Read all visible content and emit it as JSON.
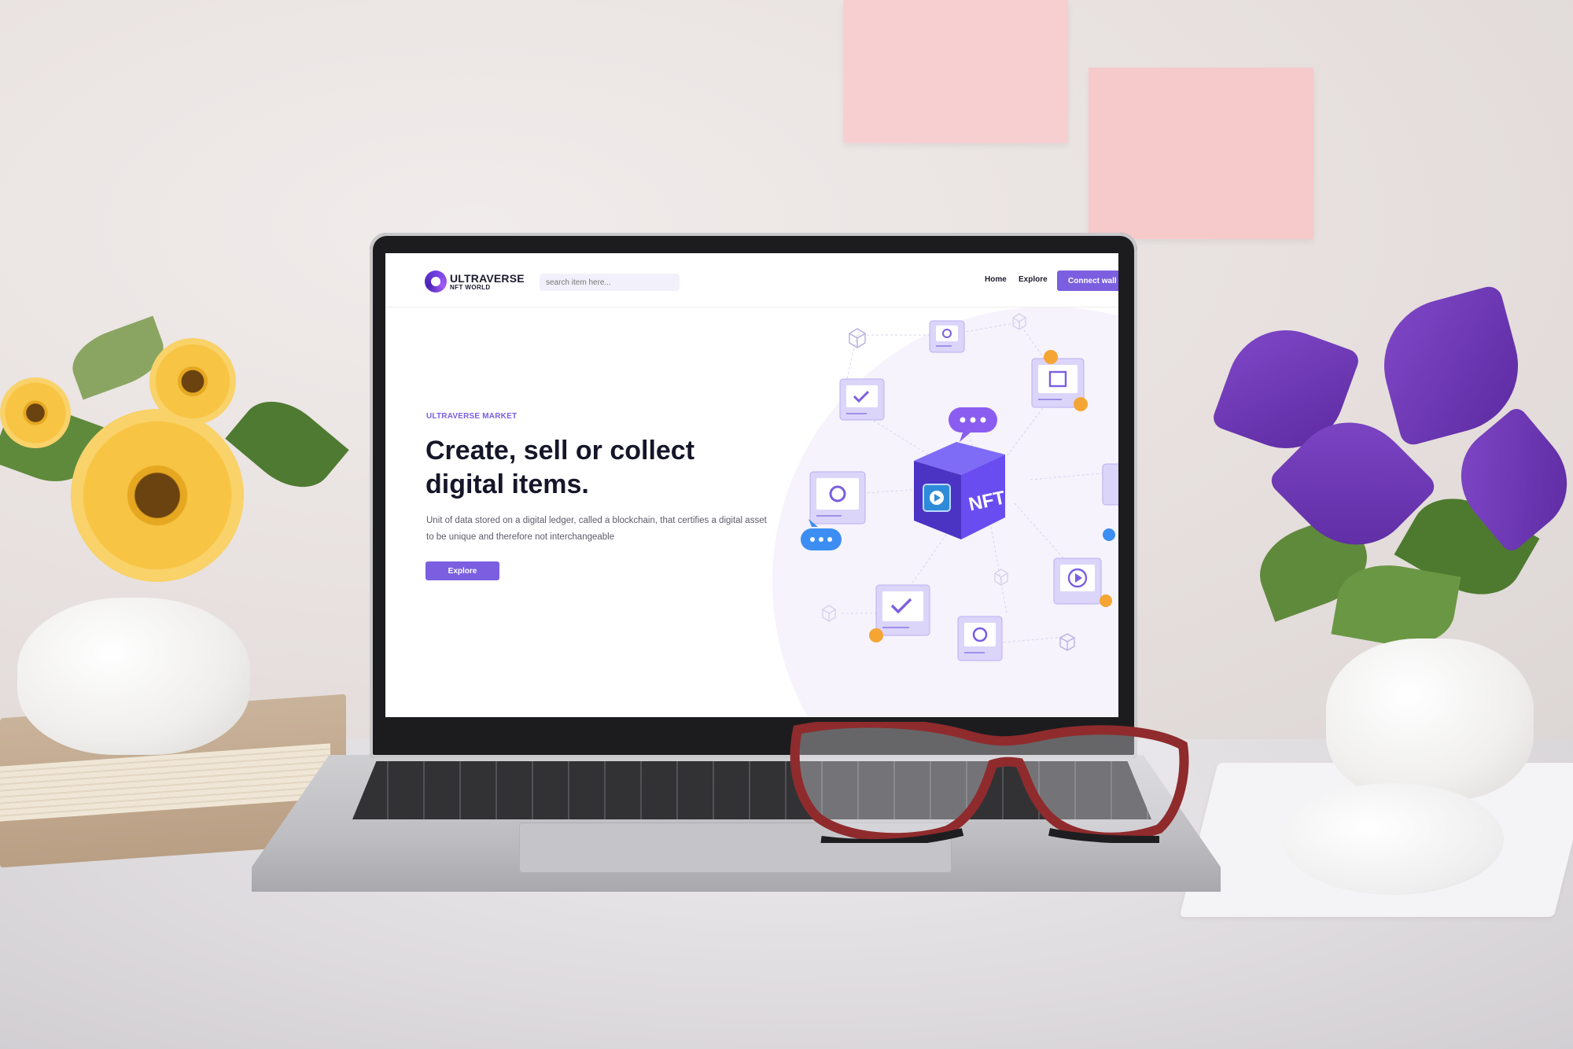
{
  "site": {
    "logo_title": "ULTRAVERSE",
    "logo_subtitle": "NFT WORLD"
  },
  "nav": {
    "search_placeholder": "search item here...",
    "links": [
      {
        "label": "Home"
      },
      {
        "label": "Explore"
      }
    ],
    "connect_label": "Connect wall"
  },
  "hero": {
    "eyebrow": "ULTRAVERSE MARKET",
    "headline_line1": "Create, sell or collect",
    "headline_line2": "digital items.",
    "description": "Unit of data stored on a digital ledger, called a blockchain, that certifies a digital asset to be unique and therefore not interchangeable",
    "explore_label": "Explore"
  },
  "illustration": {
    "cube_label": "NFT"
  },
  "colors": {
    "accent": "#7b5fe0",
    "heading": "#16162a",
    "cube_front": "#4b34c4",
    "cube_side": "#6a4df0",
    "chat_bubble_purple": "#8b5cf0",
    "chat_bubble_blue": "#3c8ef2",
    "coin": "#f5a534"
  }
}
